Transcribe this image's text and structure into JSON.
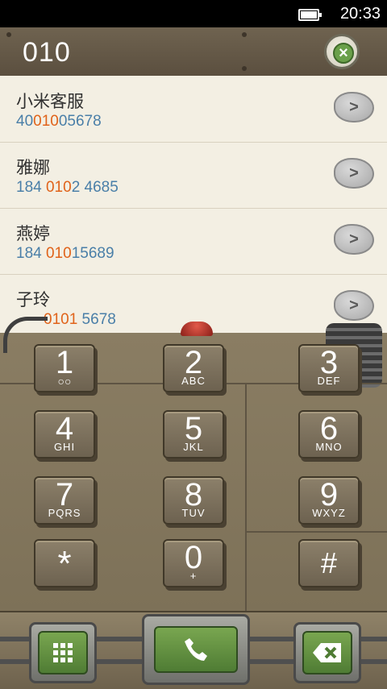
{
  "status_bar": {
    "time": "20:33",
    "battery_level": 0.9
  },
  "header": {
    "query": "010",
    "clear_icon": "clear-x-icon"
  },
  "contacts": [
    {
      "name": "小米客服",
      "number_pre": "40",
      "number_hl": "010",
      "number_post": "05678"
    },
    {
      "name": "雅娜",
      "number_pre": "184 ",
      "number_hl": "010",
      "number_post": "2 4685"
    },
    {
      "name": "燕婷",
      "number_pre": "184 ",
      "number_hl": "010",
      "number_post": "15689"
    },
    {
      "name": "子玲",
      "number_pre": "",
      "number_hl": "0101",
      "number_post": " 5678"
    }
  ],
  "keys": [
    {
      "digit": "1",
      "letters": "",
      "sub_icon": "voicemail-icon"
    },
    {
      "digit": "2",
      "letters": "ABC"
    },
    {
      "digit": "3",
      "letters": "DEF"
    },
    {
      "digit": "4",
      "letters": "GHI"
    },
    {
      "digit": "5",
      "letters": "JKL"
    },
    {
      "digit": "6",
      "letters": "MNO"
    },
    {
      "digit": "7",
      "letters": "PQRS"
    },
    {
      "digit": "8",
      "letters": "TUV"
    },
    {
      "digit": "9",
      "letters": "WXYZ"
    },
    {
      "digit": "*",
      "letters": ""
    },
    {
      "digit": "0",
      "letters": "+"
    },
    {
      "digit": "#",
      "letters": ""
    }
  ],
  "bottom": {
    "keypad_toggle_icon": "dialpad-grid-icon",
    "call_icon": "phone-handset-icon",
    "backspace_icon": "backspace-icon"
  },
  "colors": {
    "highlight": "#e0631a",
    "number": "#4a7fa8",
    "accent_green": "#5f8e3e"
  }
}
